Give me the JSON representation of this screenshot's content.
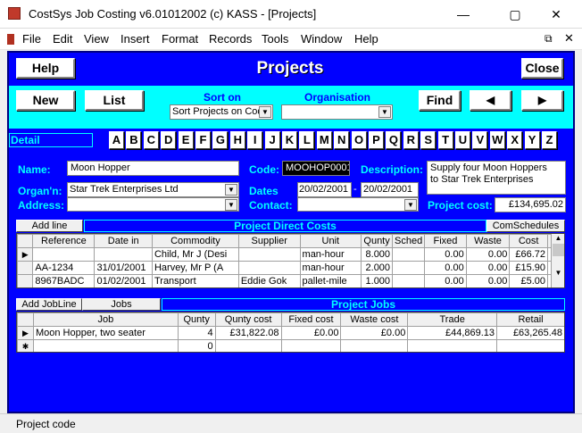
{
  "window": {
    "title": "CostSys Job Costing v6.01012002 (c) KASS - [Projects]"
  },
  "menu": [
    "File",
    "Edit",
    "View",
    "Insert",
    "Format",
    "Records",
    "Tools",
    "Window",
    "Help"
  ],
  "form": {
    "title": "Projects",
    "help_label": "Help",
    "close_label": "Close",
    "new_label": "New",
    "list_label": "List",
    "find_label": "Find",
    "prev_glyph": "◀",
    "next_glyph": "▶",
    "sort_on_label": "Sort on",
    "sort_on_value": "Sort Projects on Cod",
    "organisation_label": "Organisation",
    "organisation_filter_value": "",
    "detail_label": "Detail",
    "letters": [
      "A",
      "B",
      "C",
      "D",
      "E",
      "F",
      "G",
      "H",
      "I",
      "J",
      "K",
      "L",
      "M",
      "N",
      "O",
      "P",
      "Q",
      "R",
      "S",
      "T",
      "U",
      "V",
      "W",
      "X",
      "Y",
      "Z"
    ]
  },
  "detail": {
    "name_label": "Name:",
    "name": "Moon Hopper",
    "organ_label": "Organ'n:",
    "organisation": "Star Trek Enterprises Ltd",
    "address_label": "Address:",
    "address": "",
    "code_label": "Code:",
    "code": "MOOHOP0001",
    "dates_label": "Dates",
    "date_from": "20/02/2001",
    "date_sep": "-",
    "date_to": "20/02/2001",
    "contact_label": "Contact:",
    "contact": "",
    "description_label": "Description:",
    "description_line1": "Supply four Moon Hoppers",
    "description_line2": "to Star Trek Enterprises",
    "project_cost_label": "Project cost:",
    "project_cost": "£134,695.02"
  },
  "direct_costs": {
    "add_line_label": "Add line",
    "title": "Project Direct Costs",
    "com_schedules_label": "ComSchedules",
    "columns": [
      "Reference",
      "Date in",
      "Commodity",
      "Supplier",
      "Unit",
      "Qunty",
      "Sched",
      "Fixed",
      "Waste",
      "Cost"
    ],
    "rows": [
      {
        "marker": "▶",
        "reference": "",
        "date_in": "",
        "commodity": "Child, Mr J (Desi",
        "supplier": "",
        "unit": "man-hour",
        "qunty": "8.000",
        "sched": "",
        "fixed": "0.00",
        "waste": "0.00",
        "cost": "£66.72"
      },
      {
        "marker": "",
        "reference": "AA-1234",
        "date_in": "31/01/2001",
        "commodity": "Harvey, Mr P (A",
        "supplier": "",
        "unit": "man-hour",
        "qunty": "2.000",
        "sched": "",
        "fixed": "0.00",
        "waste": "0.00",
        "cost": "£15.90"
      },
      {
        "marker": "",
        "reference": "8967BADC",
        "date_in": "01/02/2001",
        "commodity": "Transport",
        "supplier": "Eddie Gok",
        "unit": "pallet-mile",
        "qunty": "1.000",
        "sched": "",
        "fixed": "0.00",
        "waste": "0.00",
        "cost": "£5.00"
      }
    ]
  },
  "jobs": {
    "add_jobline_label": "Add JobLine",
    "jobs_label": "Jobs",
    "title": "Project Jobs",
    "columns": [
      "Job",
      "Qunty",
      "Qunty cost",
      "Fixed cost",
      "Waste cost",
      "Trade",
      "Retail"
    ],
    "rows": [
      {
        "marker": "▶",
        "job": "Moon Hopper, two seater",
        "qunty": "4",
        "qunty_cost": "£31,822.08",
        "fixed_cost": "£0.00",
        "waste_cost": "£0.00",
        "trade": "£44,869.13",
        "retail": "£63,265.48"
      },
      {
        "marker": "✱",
        "job": "",
        "qunty": "0",
        "qunty_cost": "",
        "fixed_cost": "",
        "waste_cost": "",
        "trade": "",
        "retail": ""
      }
    ]
  },
  "status": {
    "text": "Project code"
  },
  "colors": {
    "form_bg": "#0000ff",
    "toolbar_bg": "#00ffff",
    "label_cyan": "#00ffff"
  }
}
